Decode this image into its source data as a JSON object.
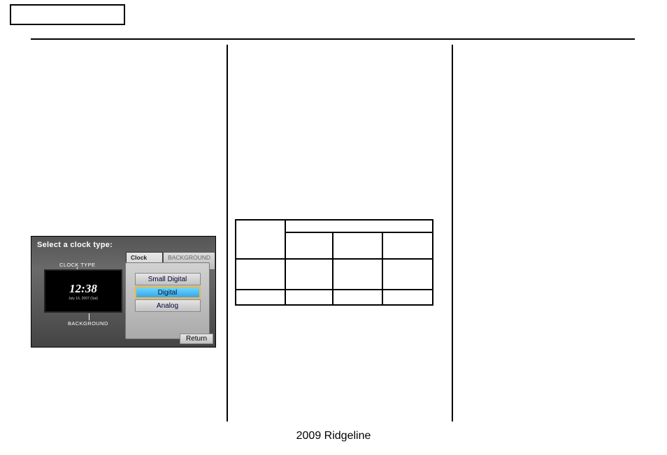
{
  "header": {
    "title": ""
  },
  "footer": {
    "text": "2009  Ridgeline"
  },
  "column1": {
    "screenshot": {
      "prompt": "Select a clock type:",
      "leftLabelTop": "CLOCK TYPE",
      "leftLabelBottom": "BACKGROUND",
      "preview": {
        "time": "12:38",
        "date": "July 16, 2007 (Sat)"
      },
      "tabs": {
        "active": "Clock Type",
        "inactive": "BACKGROUND"
      },
      "options": {
        "opt1": "Small Digital",
        "opt2": "Digital",
        "opt3": "Analog"
      },
      "returnLabel": "Return"
    }
  },
  "column2": {
    "table": {
      "rows": [
        [
          "",
          "",
          "",
          ""
        ],
        [
          "",
          "",
          "",
          ""
        ],
        [
          "",
          "",
          "",
          ""
        ],
        [
          "",
          "",
          "",
          ""
        ]
      ]
    }
  }
}
